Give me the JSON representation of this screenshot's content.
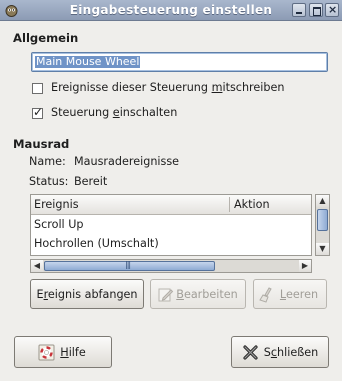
{
  "window": {
    "title": "Eingabesteuerung einstellen"
  },
  "general": {
    "heading": "Allgemein",
    "controller_name": "Main Mouse Wheel",
    "log_events_pre": "Ereignisse dieser Steuerung ",
    "log_events_ul": "m",
    "log_events_post": "itschreiben",
    "log_events_checked": false,
    "enable_pre": "Steuerung ",
    "enable_ul": "e",
    "enable_post": "inschalten",
    "enable_checked": true
  },
  "mouse_wheel": {
    "heading": "Mausrad",
    "name_label": "Name:",
    "name_value": "Mausradereignisse",
    "status_label": "Status:",
    "status_value": "Bereit",
    "columns": [
      "Ereignis",
      "Aktion"
    ],
    "rows": [
      {
        "event": "Scroll Up",
        "action": ""
      },
      {
        "event": "Hochrollen (Umschalt)",
        "action": ""
      }
    ]
  },
  "buttons": {
    "grab_pre": "E",
    "grab_ul": "r",
    "grab_post": "eignis abfangen",
    "edit_pre": "",
    "edit_ul": "B",
    "edit_post": "earbeiten",
    "clear_pre": "",
    "clear_ul": "L",
    "clear_post": "eeren",
    "help_pre": "",
    "help_ul": "H",
    "help_post": "ilfe",
    "close_pre": "S",
    "close_ul": "c",
    "close_post": "hließen"
  },
  "icons": {
    "app": "gimp-icon",
    "minimize": "minimize-icon",
    "maximize": "maximize-icon",
    "close": "close-icon",
    "edit": "edit-icon",
    "clear": "clear-brush-icon",
    "help": "help-lifebuoy-icon",
    "close_button": "close-x-icon"
  },
  "colors": {
    "titlebar": "#9aa8c0",
    "selection": "#6f93c7",
    "scroll_thumb": "#8fabd3"
  }
}
